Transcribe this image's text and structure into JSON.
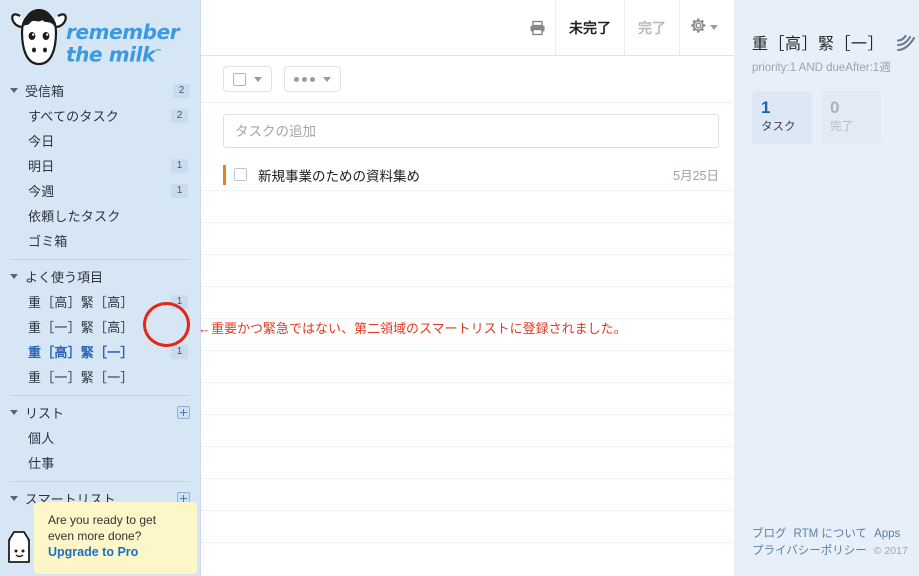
{
  "app": {
    "logo_line1": "remember",
    "logo_line2": "the milk",
    "logo_tm": "™"
  },
  "sidebar": {
    "inbox_section": {
      "label": "受信箱",
      "badge": "2",
      "items": [
        {
          "label": "すべてのタスク",
          "badge": "2"
        },
        {
          "label": "今日",
          "badge": ""
        },
        {
          "label": "明日",
          "badge": "1"
        },
        {
          "label": "今週",
          "badge": "1"
        },
        {
          "label": "依頼したタスク",
          "badge": ""
        },
        {
          "label": "ゴミ箱",
          "badge": ""
        }
      ]
    },
    "favorites_section": {
      "label": "よく使う項目",
      "items": [
        {
          "label": "重［高］緊［高］",
          "badge": "1",
          "selected": false
        },
        {
          "label": "重［一］緊［高］",
          "badge": "",
          "selected": false
        },
        {
          "label": "重［高］緊［一］",
          "badge": "1",
          "selected": true
        },
        {
          "label": "重［一］緊［一］",
          "badge": "",
          "selected": false
        }
      ]
    },
    "lists_section": {
      "label": "リスト",
      "add_label": "+",
      "items": [
        {
          "label": "個人",
          "badge": ""
        },
        {
          "label": "仕事",
          "badge": ""
        }
      ]
    },
    "smartlists_section": {
      "label": "スマートリスト",
      "add_label": "+",
      "items": []
    },
    "promo": {
      "line1": "Are you ready to get",
      "line2": "even more done?",
      "link": "Upgrade to Pro"
    }
  },
  "toolbar": {
    "print_icon": "printer-icon",
    "tab_incomplete": "未完了",
    "tab_complete": "完了",
    "gear_icon": "gear-icon"
  },
  "filterbar": {
    "select_icon": "checkbox-icon",
    "more_icon": "three-dots-icon"
  },
  "add_task": {
    "placeholder": "タスクの追加",
    "value": ""
  },
  "tasks": [
    {
      "name": "新規事業のための資料集め",
      "date": "5月25日",
      "priority_color": "#e8801d",
      "checked": false
    }
  ],
  "empty_rows": 11,
  "annotation": {
    "text": "←重要かつ緊急ではない、第二領域のスマートリストに登録されました。",
    "color": "#e03b22",
    "circle_color": "#e02718"
  },
  "right_panel": {
    "title": "重［高］緊［一］",
    "rss_icon": "rss-icon",
    "query": "priority:1 AND dueAfter:1週",
    "stats": [
      {
        "num": "1",
        "label": "タスク",
        "muted": false
      },
      {
        "num": "0",
        "label": "完了",
        "muted": true
      }
    ],
    "footer": {
      "links_row1": [
        "ブログ",
        "RTM について",
        "Apps"
      ],
      "links_row2": [
        "プライバシーポリシー"
      ],
      "copyright": "© 2017"
    }
  }
}
